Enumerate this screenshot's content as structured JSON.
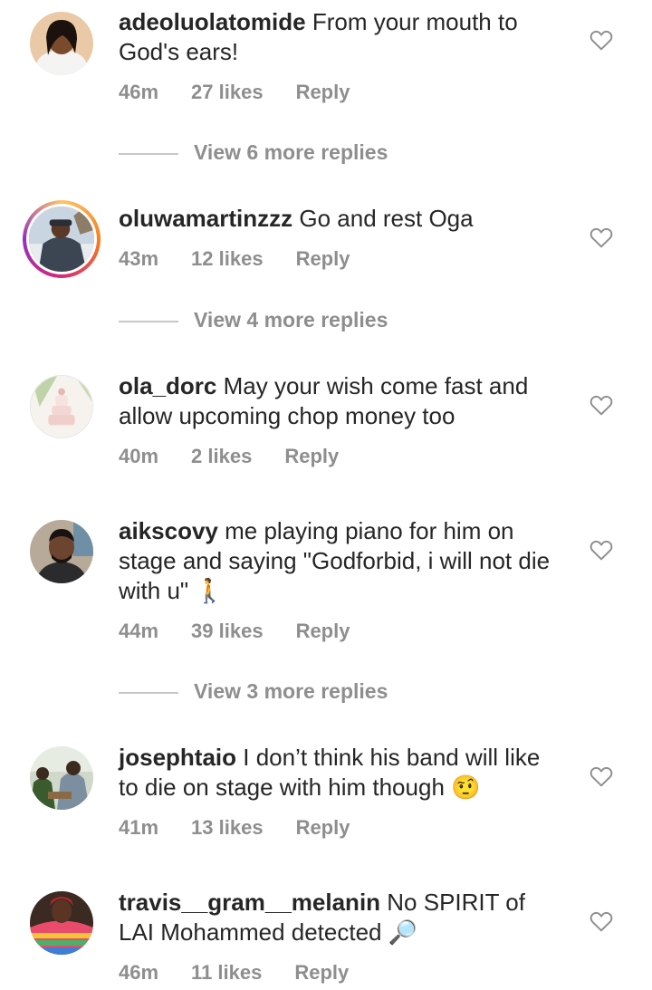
{
  "comments": [
    {
      "username": "adeoluolatomide",
      "text": "From your mouth to God's ears!",
      "time": "46m",
      "likes": "27 likes",
      "reply": "Reply",
      "view_more": "View 6 more replies"
    },
    {
      "username": "oluwamartinzzz",
      "text": "Go and rest Oga",
      "time": "43m",
      "likes": "12 likes",
      "reply": "Reply",
      "view_more": "View 4 more replies"
    },
    {
      "username": "ola_dorc",
      "text": "May your wish come fast and allow upcoming chop money too",
      "time": "40m",
      "likes": "2 likes",
      "reply": "Reply"
    },
    {
      "username": "aikscovy",
      "text": "me playing piano for him on stage and saying \"Godforbid, i will not die with u\" 🚶",
      "time": "44m",
      "likes": "39 likes",
      "reply": "Reply",
      "view_more": "View 3 more replies"
    },
    {
      "username": "josephtaio",
      "text": "I don’t think his band will like to die on stage with him though 🤨",
      "time": "41m",
      "likes": "13 likes",
      "reply": "Reply"
    },
    {
      "username": "travis__gram__melanin",
      "text": "No SPIRIT of LAI Mohammed detected 🔎",
      "time": "46m",
      "likes": "11 likes",
      "reply": "Reply"
    }
  ],
  "colors": {
    "text": "#262626",
    "secondary": "#8e8e8e",
    "divider": "#c7c7c7",
    "background": "#ffffff"
  },
  "icons": {
    "like": "heart-outline-icon"
  }
}
